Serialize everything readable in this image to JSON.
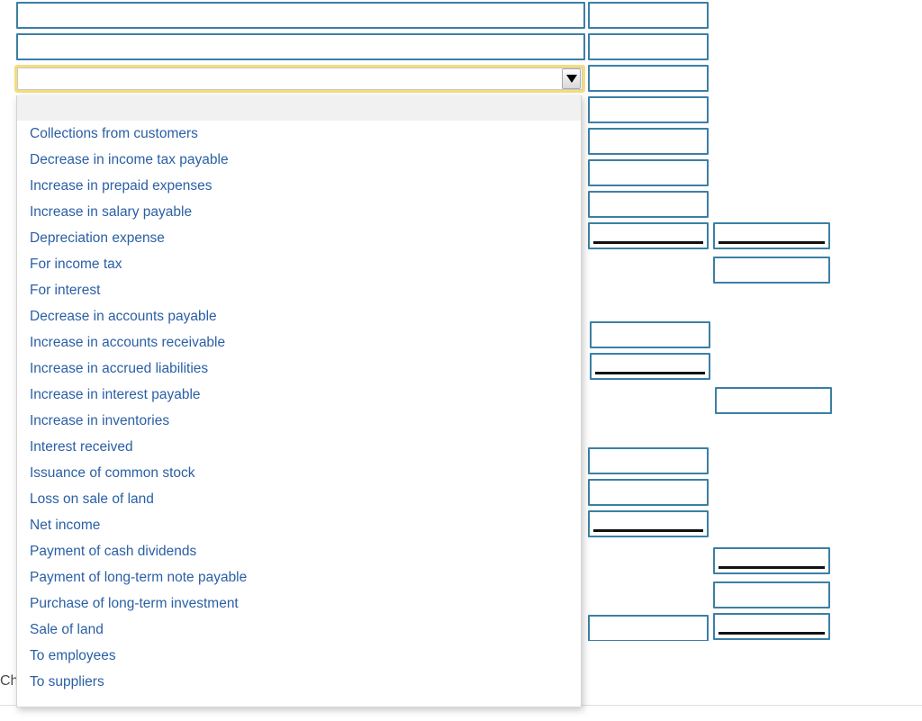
{
  "select": {
    "value": "",
    "arrow_icon": "chevron-down-icon",
    "focused": true,
    "expanded": true,
    "options": [
      "",
      "Collections from customers",
      "Decrease in income tax payable",
      "Increase in prepaid expenses",
      "Increase in salary payable",
      "Depreciation expense",
      "For income tax",
      "For interest",
      "Decrease in accounts payable",
      "Increase in accounts receivable",
      "Increase in accrued liabilities",
      "Increase in interest payable",
      "Increase in inventories",
      "Interest received",
      "Issuance of common stock",
      "Loss on sale of land",
      "Net income",
      "Payment of cash dividends",
      "Payment of long-term note payable",
      "Purchase of long-term investment",
      "Sale of land",
      "To employees",
      "To suppliers"
    ]
  },
  "footer": {
    "text": "Ch                                                                                                                                                    nue to the next question."
  },
  "form": {
    "description_fields": [
      {
        "value": ""
      },
      {
        "value": ""
      }
    ],
    "amount_column_1": [
      {
        "value": "",
        "total_rule": false
      },
      {
        "value": "",
        "total_rule": false
      },
      {
        "value": "",
        "total_rule": false
      },
      {
        "value": "",
        "total_rule": false
      },
      {
        "value": "",
        "total_rule": false
      },
      {
        "value": "",
        "total_rule": false
      },
      {
        "value": "",
        "total_rule": false
      },
      {
        "value": "",
        "total_rule": true
      },
      {
        "value": "",
        "total_rule": false
      },
      {
        "value": "",
        "total_rule": true
      },
      {
        "value": "",
        "total_rule": false
      },
      {
        "value": "",
        "total_rule": false
      },
      {
        "value": "",
        "total_rule": true
      },
      {
        "value": "",
        "total_rule": false
      }
    ],
    "amount_column_2": [
      {
        "value": "",
        "total_rule": true
      },
      {
        "value": "",
        "total_rule": false
      },
      {
        "value": "",
        "total_rule": false
      },
      {
        "value": "",
        "total_rule": true
      },
      {
        "value": "",
        "total_rule": false
      },
      {
        "value": "",
        "total_rule": true
      },
      {
        "value": "",
        "total_rule": false
      }
    ]
  },
  "colors": {
    "cell_border": "#3b7fa5",
    "option_text": "#2a5fa5",
    "focus_ring": "#f5dd7e",
    "rule": "#111111"
  }
}
